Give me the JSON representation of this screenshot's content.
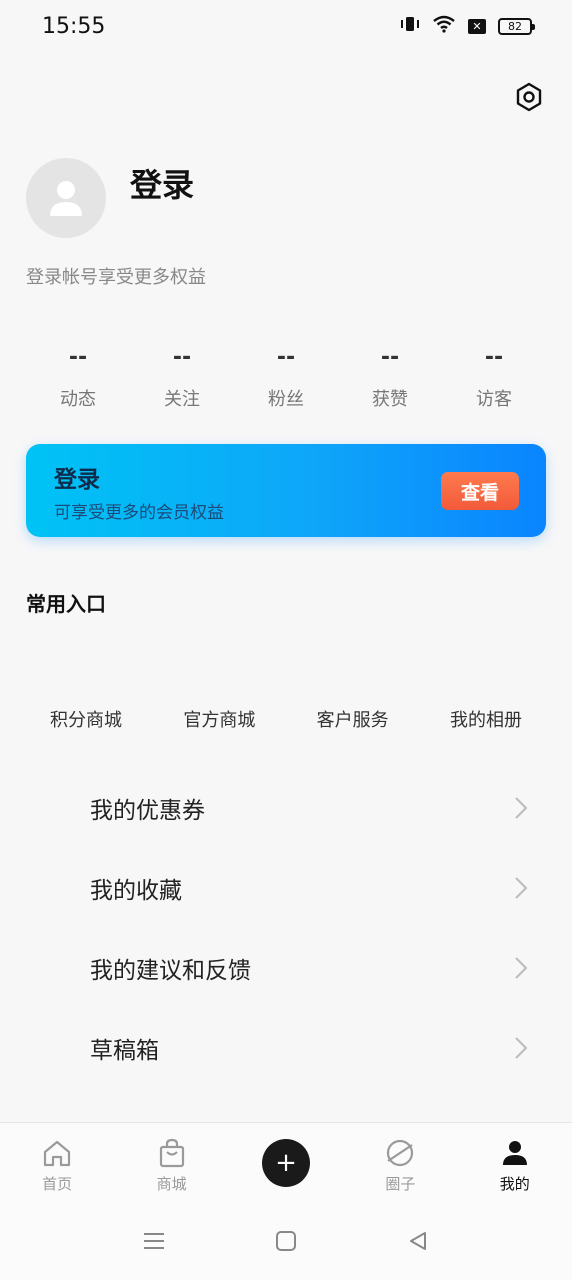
{
  "status_bar": {
    "time": "15:55",
    "battery": "82",
    "icons": [
      "vibrate-icon",
      "wifi-icon",
      "no-signal-icon",
      "battery-icon"
    ]
  },
  "header": {
    "settings_icon": "settings-icon"
  },
  "profile": {
    "title": "登录",
    "subtitle": "登录帐号享受更多权益"
  },
  "stats": [
    {
      "value": "--",
      "label": "动态"
    },
    {
      "value": "--",
      "label": "关注"
    },
    {
      "value": "--",
      "label": "粉丝"
    },
    {
      "value": "--",
      "label": "获赞"
    },
    {
      "value": "--",
      "label": "访客"
    }
  ],
  "member_card": {
    "title": "登录",
    "subtitle": "可享受更多的会员权益",
    "button": "查看",
    "accent": "#0ea6f9",
    "button_color": "#f25a3a"
  },
  "common_entries": {
    "title": "常用入口",
    "items": [
      "积分商城",
      "官方商城",
      "客户服务",
      "我的相册"
    ]
  },
  "menu": [
    {
      "label": "我的优惠券"
    },
    {
      "label": "我的收藏"
    },
    {
      "label": "我的建议和反馈"
    },
    {
      "label": "草稿箱"
    }
  ],
  "tab_bar": {
    "tabs": [
      {
        "label": "首页",
        "icon": "home-icon"
      },
      {
        "label": "商城",
        "icon": "shopping-bag-icon"
      },
      {
        "label": "",
        "icon": "plus-icon"
      },
      {
        "label": "圈子",
        "icon": "planet-icon"
      },
      {
        "label": "我的",
        "icon": "person-icon",
        "active": true
      }
    ]
  },
  "system_nav": [
    "menu-icon",
    "home-square-icon",
    "back-icon"
  ]
}
